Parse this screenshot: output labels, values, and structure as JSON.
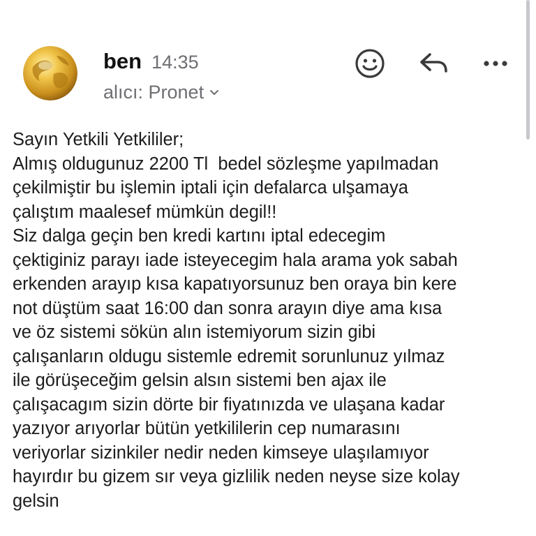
{
  "header": {
    "sender_name": "ben",
    "time": "14:35",
    "recipient": "alıcı: Pronet",
    "actions": {
      "emoji_icon": "smiley-face-icon",
      "reply_icon": "reply-arrow-icon",
      "more_icon": "more-horizontal-icon"
    },
    "avatar_icon": "golden-globe-avatar"
  },
  "message": {
    "lines": [
      "Sayın Yetkili Yetkililer;",
      "Almış oldugunuz 2200 Tl  bedel sözleşme yapılmadan",
      "çekilmiştir bu işlemin iptali için defalarca ulşamaya",
      "çalıştım maalesef mümkün degil!!",
      "Siz dalga geçin ben kredi kartını iptal edecegim",
      "çektiginiz parayı iade isteyecegim hala arama yok sabah",
      "erkenden arayıp kısa kapatıyorsunuz ben oraya bin kere",
      "not düştüm saat 16:00 dan sonra arayın diye ama kısa",
      "ve öz sistemi sökün alın istemiyorum sizin gibi",
      "çalışanların oldugu sistemle edremit sorunlunuz yılmaz",
      "ile görüşeceğim gelsin alsın sistemi ben ajax ile",
      "çalışacagım sizin dörte bir fiyatınızda ve ulaşana kadar",
      "yazıyor arıyorlar bütün yetkililerin cep numarasını",
      "veriyorlar sizinkiler nedir neden kimseye ulaşılamıyor",
      "hayırdır bu gizem sır veya gizlilik neden neyse size kolay",
      "gelsin"
    ]
  },
  "colors": {
    "text_primary": "#1c1c1e",
    "text_secondary": "#6e6e73",
    "icon": "#3a3a3c",
    "avatar_gold": "#d9a72e"
  }
}
